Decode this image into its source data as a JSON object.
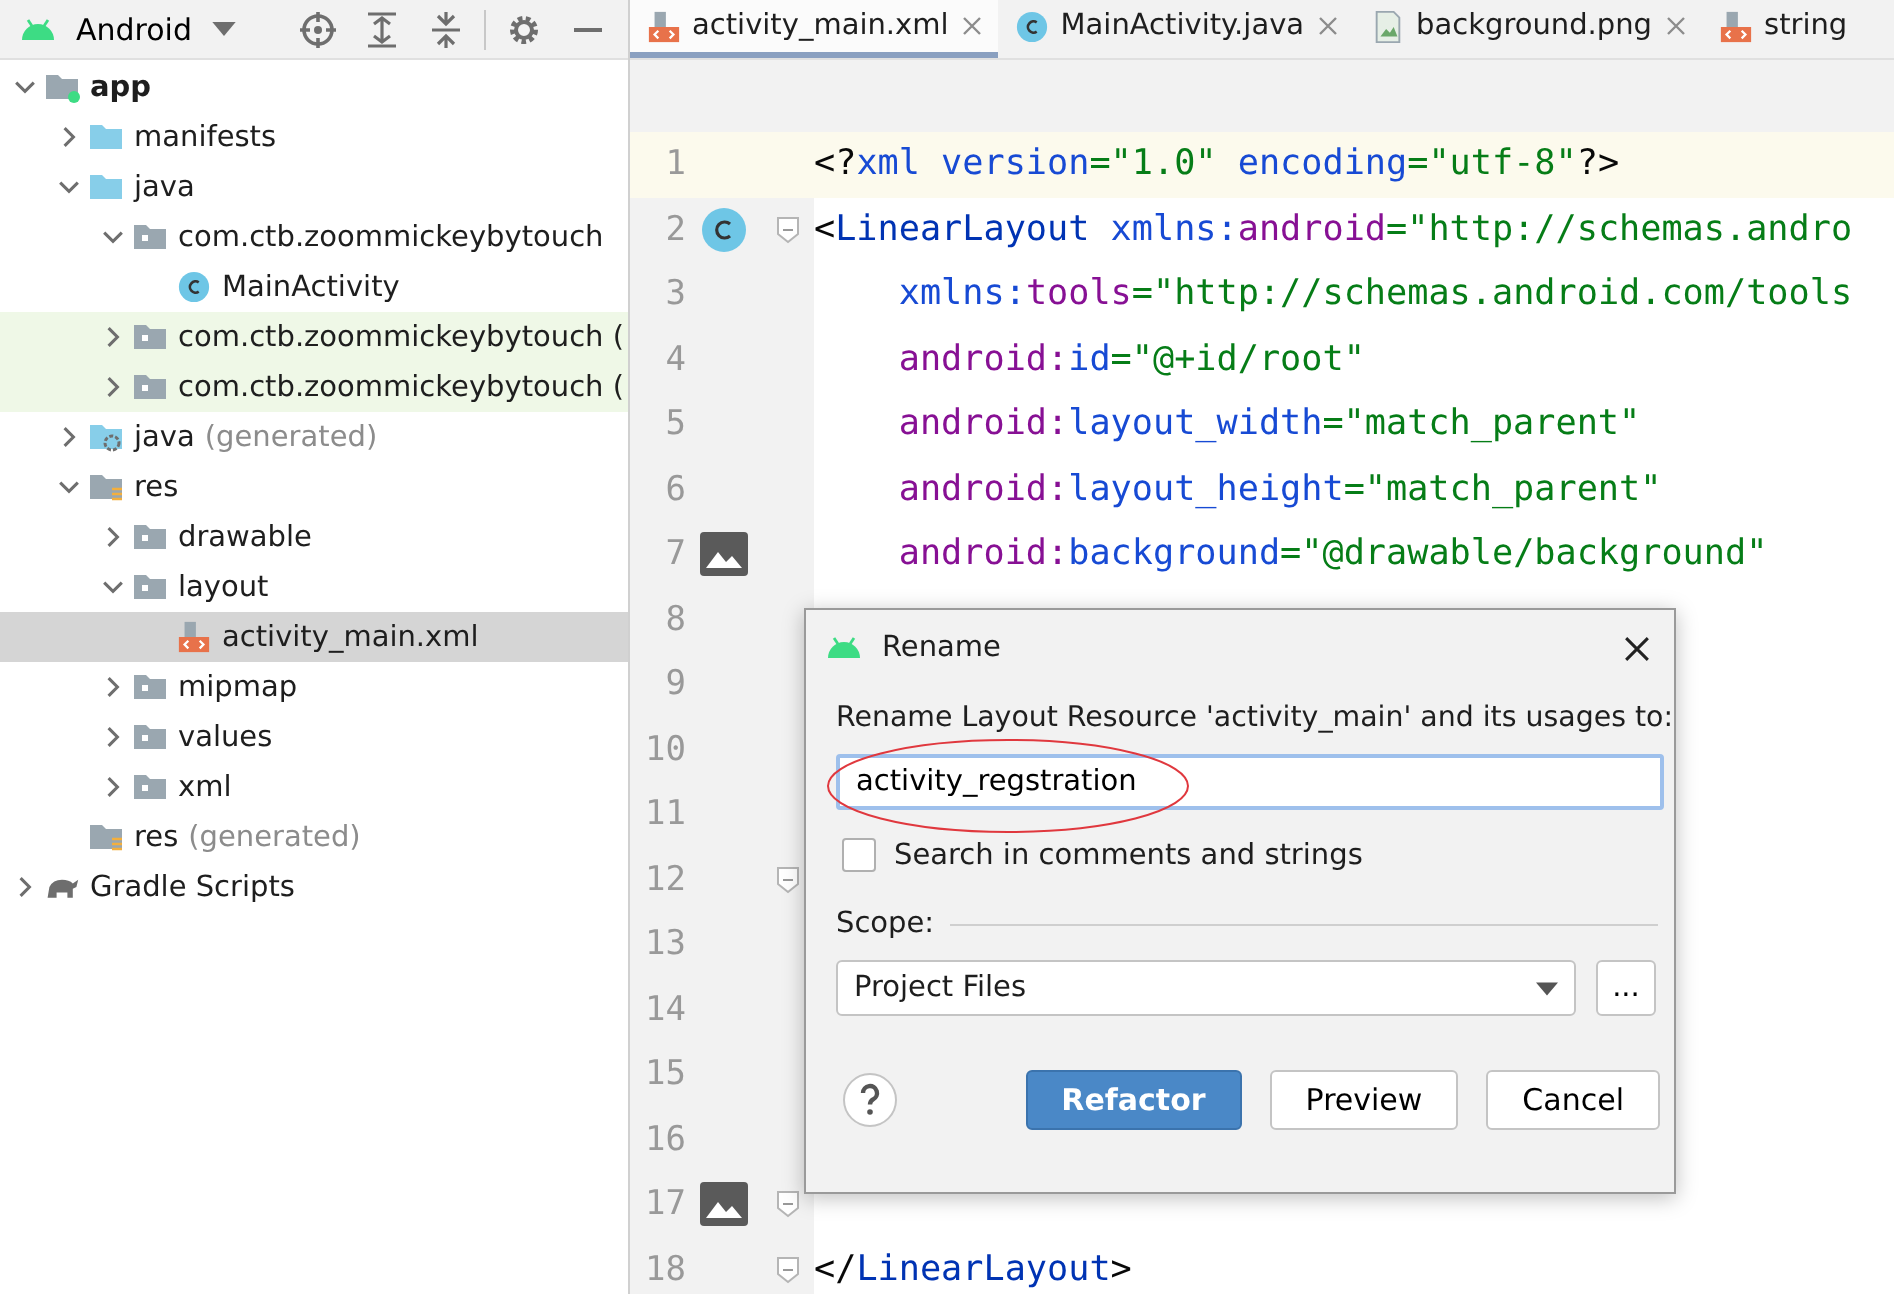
{
  "project_panel": {
    "view": "Android",
    "tree": [
      {
        "label": "app",
        "kind": "module",
        "expanded": true,
        "selected": false,
        "highlighted": false,
        "children": [
          {
            "label": "manifests",
            "kind": "folder",
            "expanded": false,
            "selected": false,
            "highlighted": false
          },
          {
            "label": "java",
            "kind": "folder",
            "expanded": true,
            "selected": false,
            "highlighted": false,
            "children": [
              {
                "label": "com.ctb.zoommickeybytouch",
                "kind": "package",
                "expanded": true,
                "selected": false,
                "highlighted": false,
                "children": [
                  {
                    "label": "MainActivity",
                    "kind": "class",
                    "selected": false,
                    "highlighted": false
                  }
                ]
              },
              {
                "label": "com.ctb.zoommickeybytouch (",
                "kind": "package",
                "expanded": false,
                "selected": false,
                "highlighted": true
              },
              {
                "label": "com.ctb.zoommickeybytouch (",
                "kind": "package",
                "expanded": false,
                "selected": false,
                "highlighted": true
              }
            ]
          },
          {
            "label": "java",
            "note": "(generated)",
            "kind": "generated",
            "expanded": false,
            "selected": false,
            "highlighted": false
          },
          {
            "label": "res",
            "kind": "resources",
            "expanded": true,
            "selected": false,
            "highlighted": false,
            "children": [
              {
                "label": "drawable",
                "kind": "package",
                "expanded": false,
                "selected": false,
                "highlighted": false
              },
              {
                "label": "layout",
                "kind": "package",
                "expanded": true,
                "selected": false,
                "highlighted": false,
                "children": [
                  {
                    "label": "activity_main.xml",
                    "kind": "xml",
                    "selected": true,
                    "highlighted": false
                  }
                ]
              },
              {
                "label": "mipmap",
                "kind": "package",
                "expanded": false,
                "selected": false,
                "highlighted": false
              },
              {
                "label": "values",
                "kind": "package",
                "expanded": false,
                "selected": false,
                "highlighted": false
              },
              {
                "label": "xml",
                "kind": "package",
                "expanded": false,
                "selected": false,
                "highlighted": false
              }
            ]
          },
          {
            "label": "res",
            "note": "(generated)",
            "kind": "resources",
            "selected": false,
            "highlighted": false
          }
        ]
      },
      {
        "label": "Gradle Scripts",
        "kind": "gradle",
        "expanded": false,
        "selected": false,
        "highlighted": false
      }
    ]
  },
  "editor": {
    "tabs": [
      {
        "label": "activity_main.xml",
        "kind": "xml",
        "selected": true,
        "closable": true
      },
      {
        "label": "MainActivity.java",
        "kind": "class",
        "selected": false,
        "closable": true
      },
      {
        "label": "background.png",
        "kind": "image",
        "selected": false,
        "closable": true
      },
      {
        "label": "string",
        "kind": "xml",
        "selected": false,
        "closable": false
      }
    ],
    "lines": [
      {
        "number": "1",
        "current": true,
        "fold": false,
        "tokens": [
          {
            "kind": "punct",
            "text": "<?"
          },
          {
            "kind": "attr",
            "text": "xml version"
          },
          {
            "kind": "value",
            "text": "=\"1.0\" "
          },
          {
            "kind": "attr",
            "text": "encoding"
          },
          {
            "kind": "value",
            "text": "=\"utf-8\""
          },
          {
            "kind": "punct",
            "text": "?>"
          }
        ]
      },
      {
        "number": "2",
        "current": false,
        "marker": {
          "kind": "class"
        },
        "fold": true,
        "tokens": [
          {
            "kind": "punct",
            "text": "<"
          },
          {
            "kind": "tag",
            "text": "LinearLayout "
          },
          {
            "kind": "attr",
            "text": "xmlns:"
          },
          {
            "kind": "ns",
            "text": "android"
          },
          {
            "kind": "value",
            "text": "=\"http://schemas.andro"
          }
        ]
      },
      {
        "number": "3",
        "current": false,
        "fold": false,
        "tokens": [
          {
            "kind": "attr",
            "text": "    xmlns:"
          },
          {
            "kind": "ns",
            "text": "tools"
          },
          {
            "kind": "value",
            "text": "=\"http://schemas.android.com/tools"
          }
        ]
      },
      {
        "number": "4",
        "current": false,
        "fold": false,
        "tokens": [
          {
            "kind": "ns",
            "text": "    android:"
          },
          {
            "kind": "attr",
            "text": "id"
          },
          {
            "kind": "value",
            "text": "=\"@+id/root\""
          }
        ]
      },
      {
        "number": "5",
        "current": false,
        "fold": false,
        "tokens": [
          {
            "kind": "ns",
            "text": "    android:"
          },
          {
            "kind": "attr",
            "text": "layout_width"
          },
          {
            "kind": "value",
            "text": "=\"match_parent\""
          }
        ]
      },
      {
        "number": "6",
        "current": false,
        "fold": false,
        "tokens": [
          {
            "kind": "ns",
            "text": "    android:"
          },
          {
            "kind": "attr",
            "text": "layout_height"
          },
          {
            "kind": "value",
            "text": "=\"match_parent\""
          }
        ]
      },
      {
        "number": "7",
        "current": false,
        "marker": {
          "kind": "image"
        },
        "fold": false,
        "tokens": [
          {
            "kind": "ns",
            "text": "    android:"
          },
          {
            "kind": "attr",
            "text": "background"
          },
          {
            "kind": "value",
            "text": "=\"@drawable/background\""
          }
        ]
      },
      {
        "number": "8",
        "current": false,
        "fold": false
      },
      {
        "number": "9",
        "current": false,
        "fold": false
      },
      {
        "number": "10",
        "current": false,
        "fold": false
      },
      {
        "number": "11",
        "current": false,
        "fold": false
      },
      {
        "number": "12",
        "current": false,
        "fold": true
      },
      {
        "number": "13",
        "current": false,
        "fold": false
      },
      {
        "number": "14",
        "current": false,
        "fold": false
      },
      {
        "number": "15",
        "current": false,
        "fold": false
      },
      {
        "number": "16",
        "current": false,
        "fold": false
      },
      {
        "number": "17",
        "current": false,
        "marker": {
          "kind": "image"
        },
        "fold": true
      },
      {
        "number": "18",
        "current": false,
        "fold": true,
        "tokens": [
          {
            "kind": "punct",
            "text": "</"
          },
          {
            "kind": "tag",
            "text": "LinearLayout"
          },
          {
            "kind": "punct",
            "text": ">"
          }
        ]
      }
    ]
  },
  "dialog": {
    "title": "Rename",
    "prompt": "Rename Layout Resource 'activity_main' and its usages to:",
    "value": "activity_regstration",
    "option": {
      "label": "Search in comments and strings",
      "checked": false
    },
    "scope_label": "Scope:",
    "scope": "Project Files",
    "browse": "...",
    "buttons": [
      {
        "label": "Refactor",
        "default": true
      },
      {
        "label": "Preview",
        "default": false
      },
      {
        "label": "Cancel",
        "default": false
      }
    ]
  }
}
